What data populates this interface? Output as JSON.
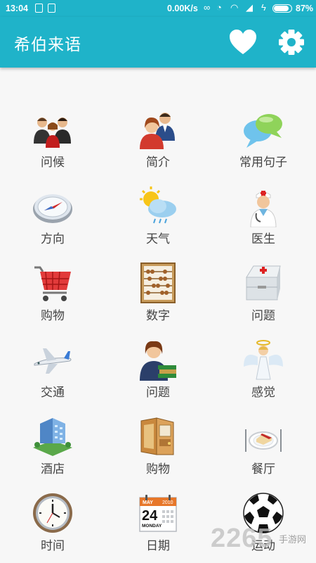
{
  "status_bar": {
    "time": "13:04",
    "network_speed": "0.00K/s",
    "battery_percent": "87%",
    "battery_level": 0.87
  },
  "app_bar": {
    "title": "希伯来语",
    "favorites_icon": "heart-icon",
    "settings_icon": "gear-icon",
    "color": "#1fb3c9"
  },
  "categories": [
    {
      "label": "问候",
      "icon": "greeting-people-icon"
    },
    {
      "label": "简介",
      "icon": "introduction-people-icon"
    },
    {
      "label": "常用句子",
      "icon": "speech-bubbles-icon"
    },
    {
      "label": "方向",
      "icon": "compass-icon"
    },
    {
      "label": "天气",
      "icon": "weather-icon"
    },
    {
      "label": "医生",
      "icon": "doctor-icon"
    },
    {
      "label": "购物",
      "icon": "shopping-cart-icon"
    },
    {
      "label": "数字",
      "icon": "abacus-icon"
    },
    {
      "label": "问题",
      "icon": "first-aid-kit-icon"
    },
    {
      "label": "交通",
      "icon": "airplane-icon"
    },
    {
      "label": "问题",
      "icon": "student-books-icon"
    },
    {
      "label": "感觉",
      "icon": "angel-icon"
    },
    {
      "label": "酒店",
      "icon": "hotel-building-icon"
    },
    {
      "label": "购物",
      "icon": "wallet-icon"
    },
    {
      "label": "餐厅",
      "icon": "restaurant-plate-icon"
    },
    {
      "label": "时间",
      "icon": "clock-icon"
    },
    {
      "label": "日期",
      "icon": "calendar-icon"
    },
    {
      "label": "运动",
      "icon": "soccer-ball-icon"
    }
  ],
  "calendar_icon_text": {
    "month": "MAY",
    "year": "2010",
    "day": "24",
    "weekday": "MONDAY"
  },
  "watermark": {
    "number": "2265",
    "site": "手游网"
  }
}
